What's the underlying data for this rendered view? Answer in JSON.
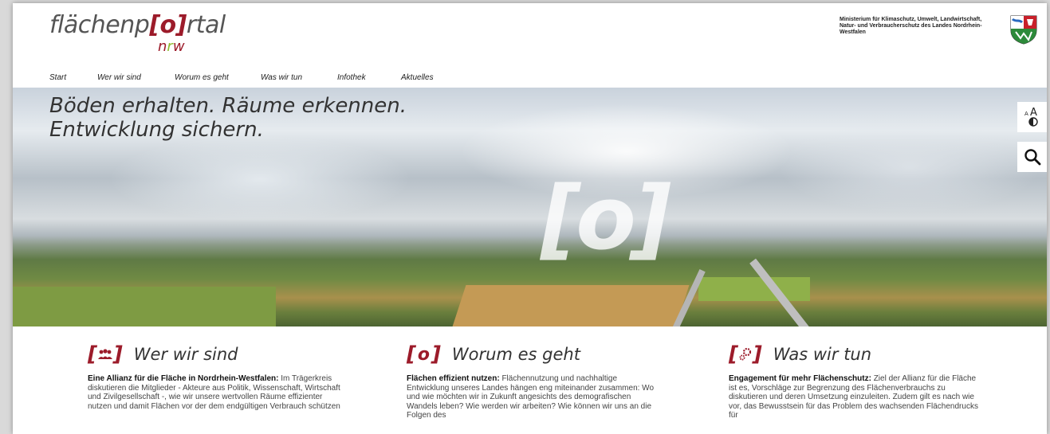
{
  "header": {
    "logo": {
      "part1": "flächenp",
      "bracket_open": "[",
      "o": "o",
      "bracket_close": "]",
      "part2": "rtal",
      "sub_n": "n",
      "sub_r": "r",
      "sub_w": "w"
    },
    "ministry": "Ministerium für Klimaschutz, Umwelt, Landwirtschaft, Natur- und Verbraucherschutz des Landes Nordrhein-Westfalen",
    "crest_icon": "nrw-coat-of-arms-icon"
  },
  "nav": {
    "items": [
      {
        "label": "Start"
      },
      {
        "label": "Wer wir sind"
      },
      {
        "label": "Worum es geht"
      },
      {
        "label": "Was wir tun"
      },
      {
        "label": "Infothek"
      },
      {
        "label": "Aktuelles"
      }
    ]
  },
  "hero": {
    "line1": "Böden erhalten. Räume erkennen.",
    "line2": "Entwicklung sichern.",
    "mark": "[o]"
  },
  "tools": {
    "font_size_small": "A",
    "font_size_large": "A",
    "contrast_icon": "contrast-icon",
    "search_icon": "search-icon"
  },
  "columns": [
    {
      "icon": "people-icon",
      "title": "Wer wir sind",
      "lead": "Eine Allianz für die Fläche in Nordrhein-Westfalen:",
      "text": " Im Trägerkreis diskutieren die Mitglieder - Akteure aus Politik, Wissenschaft, Wirtschaft und Zivilgesellschaft -, wie wir unsere wertvollen Räume effizienter nutzen und damit Flächen vor der dem endgültigen Verbrauch schützen"
    },
    {
      "icon": "o-icon",
      "icon_text": "o",
      "title": "Worum es geht",
      "lead": "Flächen effizient nutzen:",
      "text": " Flächennutzung und nachhaltige Entwicklung unseres Landes hängen eng miteinander zusammen: Wo und wie möchten wir in Zukunft angesichts des demografischen Wandels leben? Wie werden wir arbeiten? Wie können wir uns an die Folgen des"
    },
    {
      "icon": "gears-icon",
      "title": "Was wir tun",
      "lead": "Engagement für mehr Flächenschutz:",
      "text": " Ziel der Allianz für die Fläche ist es, Vorschläge zur Begrenzung des Flächenverbrauchs zu diskutieren und deren Umsetzung einzuleiten. Zudem gilt es nach wie vor, das Bewusstsein für das Problem des wachsenden Flächendrucks für"
    }
  ],
  "colors": {
    "brand_red": "#9c1b2a",
    "brand_green": "#8dbb2f",
    "text": "#333333"
  }
}
